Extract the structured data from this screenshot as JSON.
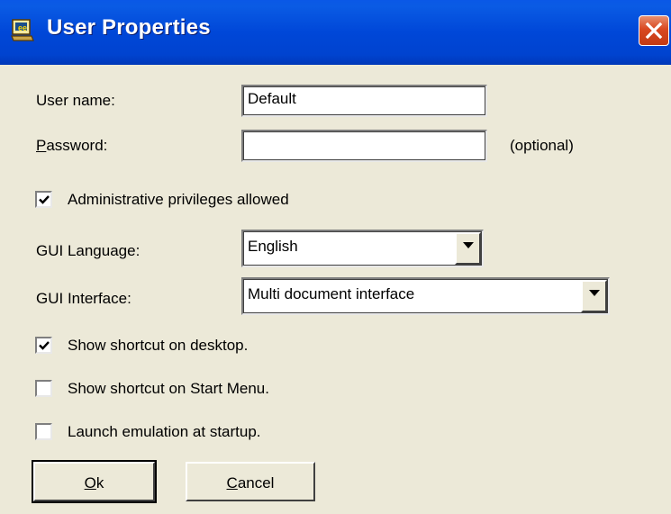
{
  "window": {
    "title": "User Properties"
  },
  "form": {
    "user_name_label": "User name:",
    "user_name_value": "Default",
    "password_label_mnemonic": "P",
    "password_label_rest": "assword:",
    "password_value": "",
    "password_note": "(optional)",
    "admin_label": "Administrative privileges allowed",
    "admin_checked": true,
    "gui_language_label": "GUI Language:",
    "gui_language_value": "English",
    "gui_interface_label": "GUI Interface:",
    "gui_interface_value": "Multi document interface",
    "shortcut_desktop_label": "Show shortcut on desktop.",
    "shortcut_desktop_checked": true,
    "shortcut_start_label": "Show shortcut on Start Menu.",
    "shortcut_start_checked": false,
    "launch_label": "Launch emulation at startup.",
    "launch_checked": false
  },
  "buttons": {
    "ok_mnemonic": "O",
    "ok_rest": "k",
    "cancel_mnemonic": "C",
    "cancel_rest": "ancel"
  },
  "icons": {
    "app": "terminal-emulator-icon",
    "close": "close-icon",
    "dropdown": "chevron-down-icon",
    "check": "check-icon"
  },
  "colors": {
    "titlebar": "#0047d8",
    "close_button": "#d94820",
    "dialog_face": "#ece9d8"
  }
}
